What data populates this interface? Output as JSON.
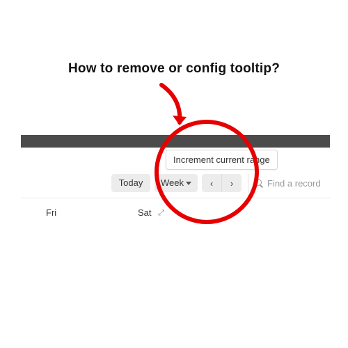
{
  "annotation": {
    "question": "How to remove or config  tooltip?",
    "circle_color": "#e60000",
    "arrow_color": "#e60000"
  },
  "tooltip": {
    "text": "Increment current range"
  },
  "toolbar": {
    "today_label": "Today",
    "view_select": {
      "label": "Week"
    },
    "prev_glyph": "‹",
    "next_glyph": "›"
  },
  "search": {
    "placeholder": "Find a record"
  },
  "columns": {
    "fri": "Fri",
    "sat": "Sat"
  }
}
